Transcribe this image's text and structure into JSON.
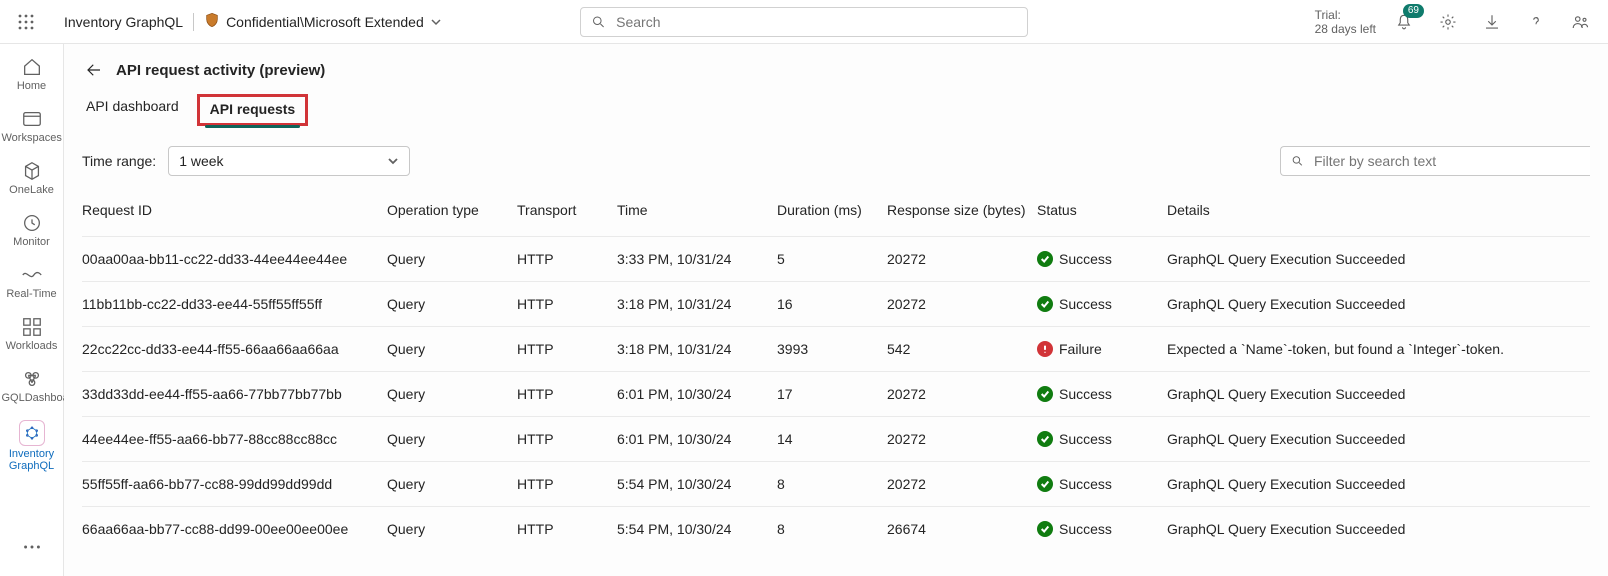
{
  "topbar": {
    "app_name": "Inventory GraphQL",
    "sensitivity_label": "Confidential\\Microsoft Extended",
    "search_placeholder": "Search",
    "trial_line1": "Trial:",
    "trial_line2": "28 days left",
    "notification_badge": "69"
  },
  "leftnav": {
    "items": [
      {
        "label": "Home"
      },
      {
        "label": "Workspaces"
      },
      {
        "label": "OneLake"
      },
      {
        "label": "Monitor"
      },
      {
        "label": "Real-Time"
      },
      {
        "label": "Workloads"
      },
      {
        "label": "GQLDashboard"
      },
      {
        "label": "Inventory GraphQL"
      }
    ]
  },
  "page": {
    "title": "API request activity (preview)",
    "tabs": [
      {
        "label": "API dashboard"
      },
      {
        "label": "API requests"
      }
    ],
    "time_range_label": "Time range:",
    "time_range_value": "1 week",
    "filter_placeholder": "Filter by search text"
  },
  "table": {
    "columns": [
      "Request ID",
      "Operation type",
      "Transport",
      "Time",
      "Duration (ms)",
      "Response size (bytes)",
      "Status",
      "Details"
    ],
    "rows": [
      {
        "id": "00aa00aa-bb11-cc22-dd33-44ee44ee44ee",
        "op": "Query",
        "transport": "HTTP",
        "time": "3:33 PM, 10/31/24",
        "duration": "5",
        "size": "20272",
        "status": "Success",
        "details": "GraphQL Query Execution Succeeded"
      },
      {
        "id": "11bb11bb-cc22-dd33-ee44-55ff55ff55ff",
        "op": "Query",
        "transport": "HTTP",
        "time": "3:18 PM, 10/31/24",
        "duration": "16",
        "size": "20272",
        "status": "Success",
        "details": "GraphQL Query Execution Succeeded"
      },
      {
        "id": "22cc22cc-dd33-ee44-ff55-66aa66aa66aa",
        "op": "Query",
        "transport": "HTTP",
        "time": "3:18 PM, 10/31/24",
        "duration": "3993",
        "size": "542",
        "status": "Failure",
        "details": "Expected a `Name`-token, but found a `Integer`-token."
      },
      {
        "id": "33dd33dd-ee44-ff55-aa66-77bb77bb77bb",
        "op": "Query",
        "transport": "HTTP",
        "time": "6:01 PM, 10/30/24",
        "duration": "17",
        "size": "20272",
        "status": "Success",
        "details": "GraphQL Query Execution Succeeded"
      },
      {
        "id": "44ee44ee-ff55-aa66-bb77-88cc88cc88cc",
        "op": "Query",
        "transport": "HTTP",
        "time": "6:01 PM, 10/30/24",
        "duration": "14",
        "size": "20272",
        "status": "Success",
        "details": "GraphQL Query Execution Succeeded"
      },
      {
        "id": "55ff55ff-aa66-bb77-cc88-99dd99dd99dd",
        "op": "Query",
        "transport": "HTTP",
        "time": "5:54 PM, 10/30/24",
        "duration": "8",
        "size": "20272",
        "status": "Success",
        "details": "GraphQL Query Execution Succeeded"
      },
      {
        "id": "66aa66aa-bb77-cc88-dd99-00ee00ee00ee",
        "op": "Query",
        "transport": "HTTP",
        "time": "5:54 PM, 10/30/24",
        "duration": "8",
        "size": "26674",
        "status": "Success",
        "details": "GraphQL Query Execution Succeeded"
      }
    ]
  }
}
